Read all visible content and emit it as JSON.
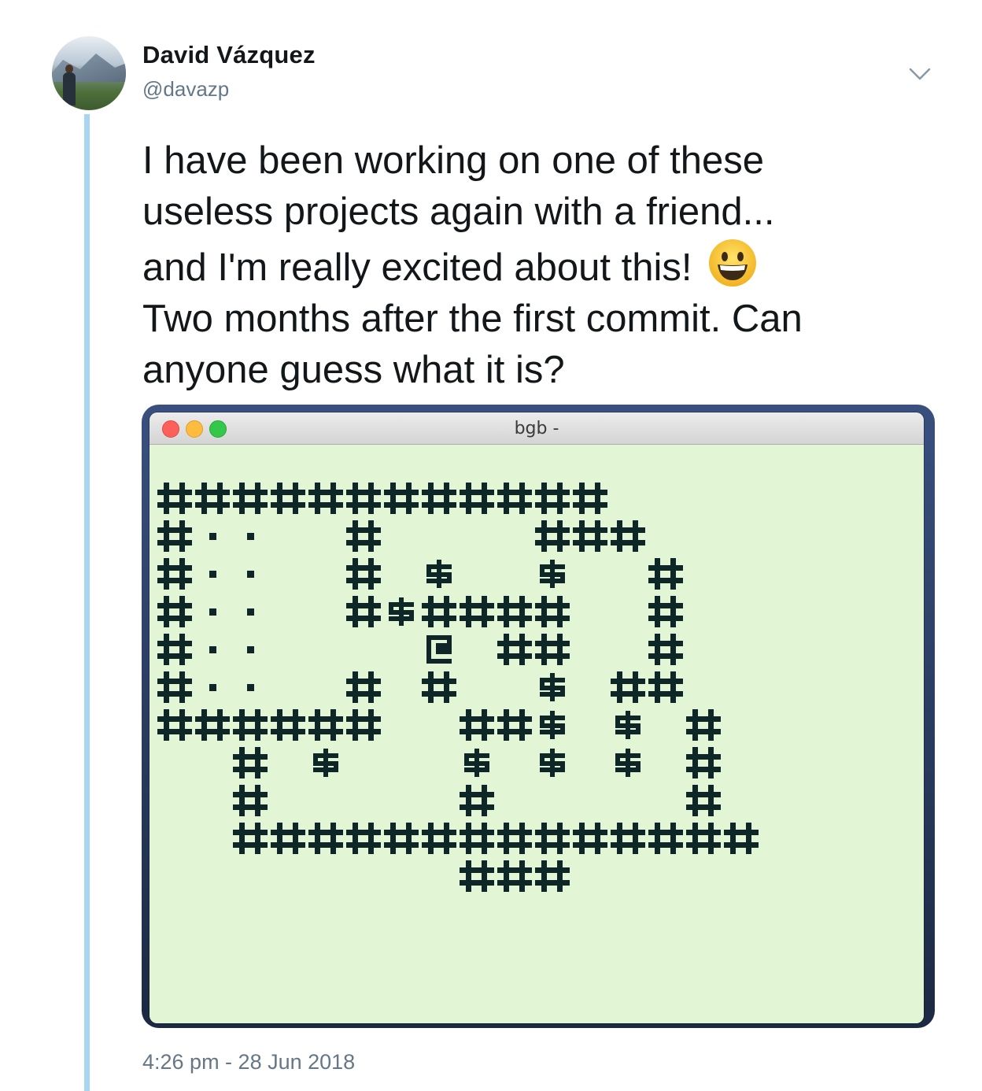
{
  "tweet": {
    "author_name": "David Vázquez",
    "author_handle": "@davazp",
    "text": "I have been working on one of these\nuseless projects again with a friend...\nand I'm really excited about this! ",
    "text_after_emoji": "\nTwo months after the first commit. Can\nanyone guess what it is?",
    "emoji": "grinning-face-icon",
    "timestamp": "4:26 pm - 28 Jun 2018"
  },
  "media": {
    "window_title": "bgb -",
    "screen_color": "#e2f6d6",
    "glyph_color": "#0f2628",
    "map_rows": [
      "############",
      "#..  #    ###",
      "#..  # $  $  #",
      "#..  #$####  #",
      "#..    @ ##  #",
      "#..  # #  $ ##",
      "######  ##$ $ #",
      "  # $   $ $ $ #",
      "  #     #     #",
      "  ##############",
      "        ###"
    ]
  }
}
